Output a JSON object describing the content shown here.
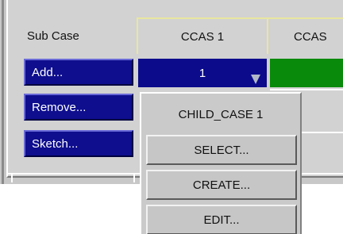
{
  "table": {
    "header": {
      "sub_case": "Sub Case",
      "ccas1": "CCAS 1",
      "ccas2": "CCAS"
    },
    "buttons": {
      "add": "Add...",
      "remove": "Remove...",
      "sketch": "Sketch..."
    },
    "selected_value": "1"
  },
  "popup": {
    "title": "CHILD_CASE 1",
    "items": [
      "SELECT...",
      "CREATE...",
      "EDIT..."
    ]
  },
  "colors": {
    "panel": "#d2d2d2",
    "button_blue": "#0e0e8e",
    "cell_green": "#0a8a0a",
    "header_border": "#e8e6a0"
  }
}
